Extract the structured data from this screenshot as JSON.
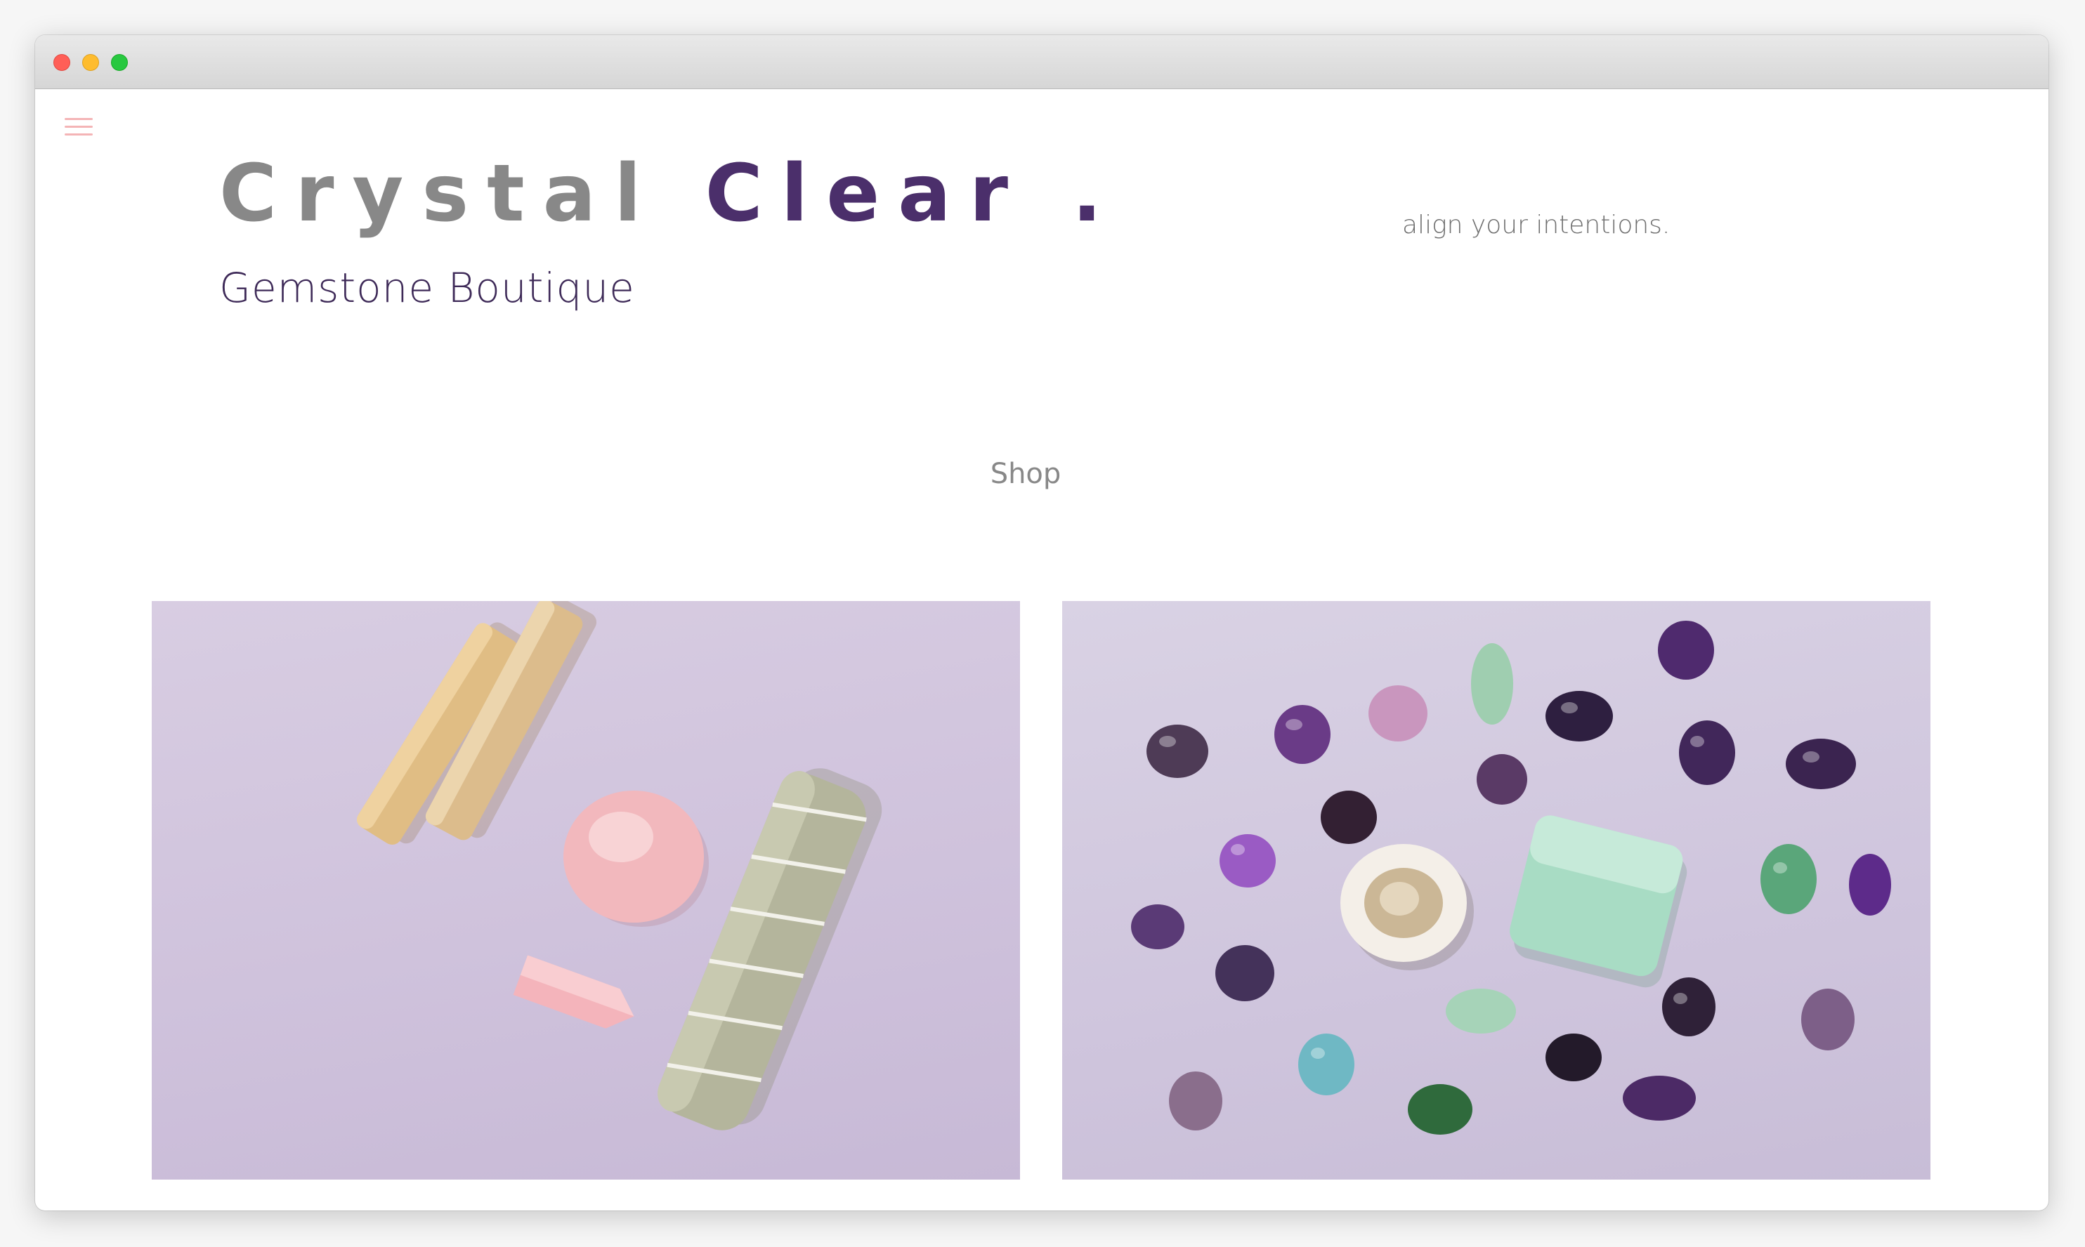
{
  "header": {
    "brand_part1": "Crystal ",
    "brand_part2": "Clear .",
    "subtitle": "Gemstone Boutique",
    "tagline": "align your intentions."
  },
  "nav": {
    "shop_label": "Shop",
    "menu_icon": "hamburger-menu-icon"
  },
  "gallery": {
    "images": [
      {
        "alt": "palo santo sticks, rose quartz and sage bundle"
      },
      {
        "alt": "assorted tumbled gemstones"
      }
    ]
  },
  "colors": {
    "brand_gray": "#888888",
    "brand_purple": "#4b2f6b",
    "menu_pink": "#f4b4b6",
    "photo_background": "#d4c9df"
  }
}
